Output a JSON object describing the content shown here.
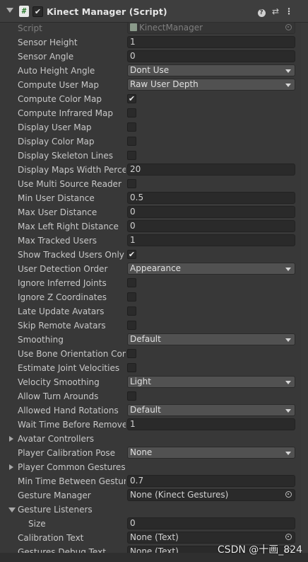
{
  "component": {
    "title": "Kinect Manager (Script)",
    "enabled_check": "✔",
    "help_glyph": "?",
    "preset_glyph": "⇄",
    "menu_glyph": "⋮"
  },
  "rows": [
    {
      "label": "Script",
      "type": "object",
      "value": "KinectManager",
      "dim": true
    },
    {
      "label": "Sensor Height",
      "type": "field",
      "value": "1"
    },
    {
      "label": "Sensor Angle",
      "type": "field",
      "value": "0"
    },
    {
      "label": "Auto Height Angle",
      "type": "dropdown",
      "value": "Dont Use"
    },
    {
      "label": "Compute User Map",
      "type": "dropdown",
      "value": "Raw User Depth"
    },
    {
      "label": "Compute Color Map",
      "type": "toggle",
      "checked": true
    },
    {
      "label": "Compute Infrared Map",
      "type": "toggle",
      "checked": false
    },
    {
      "label": "Display User Map",
      "type": "toggle",
      "checked": false
    },
    {
      "label": "Display Color Map",
      "type": "toggle",
      "checked": false
    },
    {
      "label": "Display Skeleton Lines",
      "type": "toggle",
      "checked": false
    },
    {
      "label": "Display Maps Width Percent",
      "type": "field",
      "value": "20"
    },
    {
      "label": "Use Multi Source Reader",
      "type": "toggle",
      "checked": false
    },
    {
      "label": "Min User Distance",
      "type": "field",
      "value": "0.5"
    },
    {
      "label": "Max User Distance",
      "type": "field",
      "value": "0"
    },
    {
      "label": "Max Left Right Distance",
      "type": "field",
      "value": "0"
    },
    {
      "label": "Max Tracked Users",
      "type": "field",
      "value": "1"
    },
    {
      "label": "Show Tracked Users Only",
      "type": "toggle",
      "checked": true
    },
    {
      "label": "User Detection Order",
      "type": "dropdown",
      "value": "Appearance"
    },
    {
      "label": "Ignore Inferred Joints",
      "type": "toggle",
      "checked": false
    },
    {
      "label": "Ignore Z Coordinates",
      "type": "toggle",
      "checked": false
    },
    {
      "label": "Late Update Avatars",
      "type": "toggle",
      "checked": false
    },
    {
      "label": "Skip Remote Avatars",
      "type": "toggle",
      "checked": false
    },
    {
      "label": "Smoothing",
      "type": "dropdown",
      "value": "Default"
    },
    {
      "label": "Use Bone Orientation Constraints",
      "type": "toggle",
      "checked": false
    },
    {
      "label": "Estimate Joint Velocities",
      "type": "toggle",
      "checked": false
    },
    {
      "label": "Velocity Smoothing",
      "type": "dropdown",
      "value": "Light"
    },
    {
      "label": "Allow Turn Arounds",
      "type": "toggle",
      "checked": false
    },
    {
      "label": "Allowed Hand Rotations",
      "type": "dropdown",
      "value": "Default"
    },
    {
      "label": "Wait Time Before Remove",
      "type": "field",
      "value": "1"
    },
    {
      "label": "Avatar Controllers",
      "type": "foldout",
      "open": false
    },
    {
      "label": "Player Calibration Pose",
      "type": "dropdown",
      "value": "None"
    },
    {
      "label": "Player Common Gestures",
      "type": "foldout",
      "open": false
    },
    {
      "label": "Min Time Between Gestures",
      "type": "field",
      "value": "0.7"
    },
    {
      "label": "Gesture Manager",
      "type": "object",
      "value": "None (Kinect Gestures)",
      "dim": false
    },
    {
      "label": "Gesture Listeners",
      "type": "foldout",
      "open": true
    },
    {
      "label": "Size",
      "type": "field",
      "value": "0",
      "indent": true
    },
    {
      "label": "Calibration Text",
      "type": "object",
      "value": "None (Text)",
      "dim": false
    },
    {
      "label": "Gestures Debug Text",
      "type": "object",
      "value": "None (Text)",
      "dim": false
    }
  ],
  "check_glyph": "✔",
  "watermark": "CSDN @十画_824",
  "colors": {
    "background": "#383838",
    "header": "#3e3e3e",
    "field": "#2a2a2a",
    "dropdown": "#515151",
    "text": "#c8c8c8"
  }
}
